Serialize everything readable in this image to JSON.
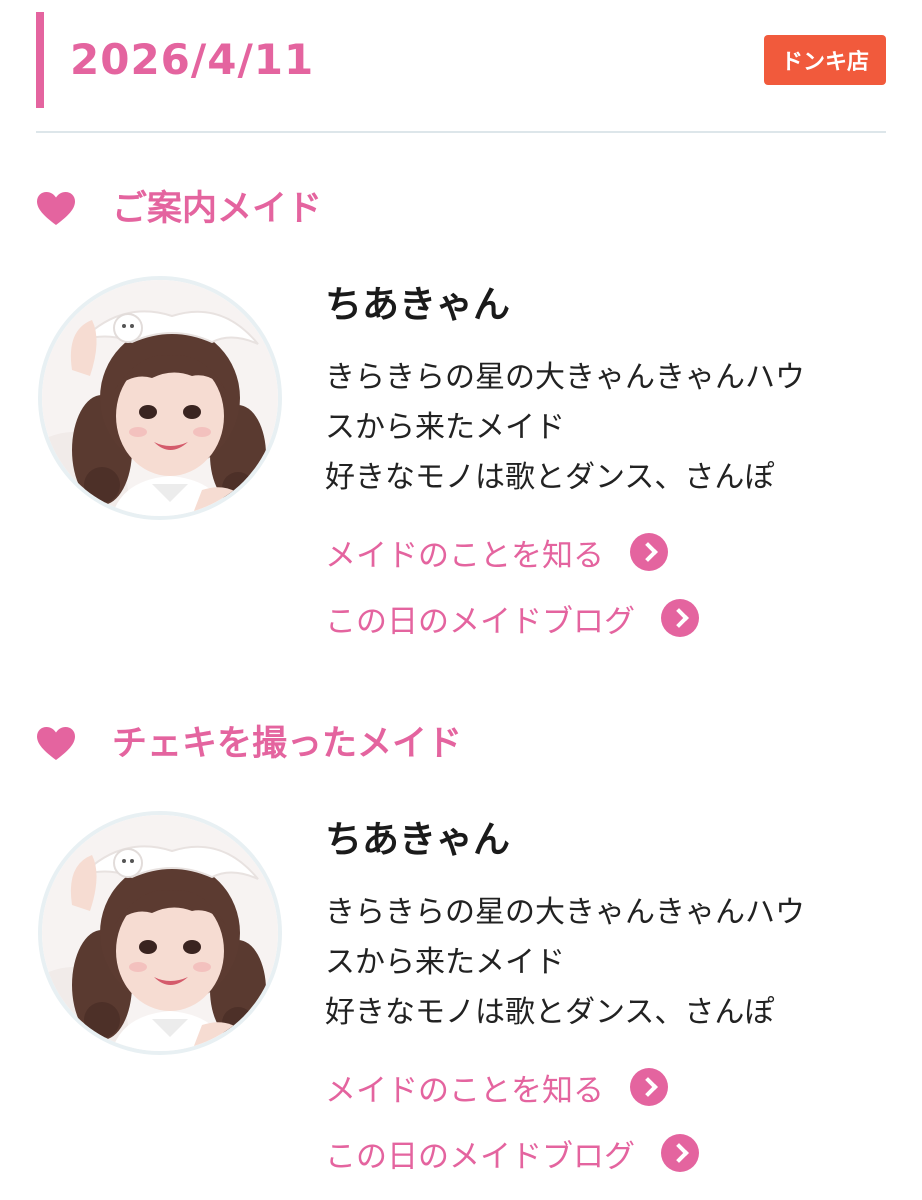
{
  "header": {
    "date": "2026/4/11",
    "store_badge": "ドンキ店"
  },
  "sections": [
    {
      "heading": "ご案内メイド",
      "maid": {
        "name": "ちあきゃん",
        "description_lines": [
          "きらきらの星の大きゃんきゃんハウ",
          "スから来たメイド",
          "好きなモノは歌とダンス、さんぽ"
        ],
        "link_profile": "メイドのことを知る",
        "link_blog": "この日のメイドブログ"
      }
    },
    {
      "heading": "チェキを撮ったメイド",
      "maid": {
        "name": "ちあきゃん",
        "description_lines": [
          "きらきらの星の大きゃんきゃんハウ",
          "スから来たメイド",
          "好きなモノは歌とダンス、さんぽ"
        ],
        "link_profile": "メイドのことを知る",
        "link_blog": "この日のメイドブログ"
      }
    }
  ],
  "colors": {
    "accent_pink": "#e4649f",
    "badge_red": "#f15a3c",
    "text_dark": "#222222",
    "divider": "#dde6ea"
  },
  "icons": {
    "heading": "heart-icon",
    "link": "chevron-right-circle-icon"
  }
}
